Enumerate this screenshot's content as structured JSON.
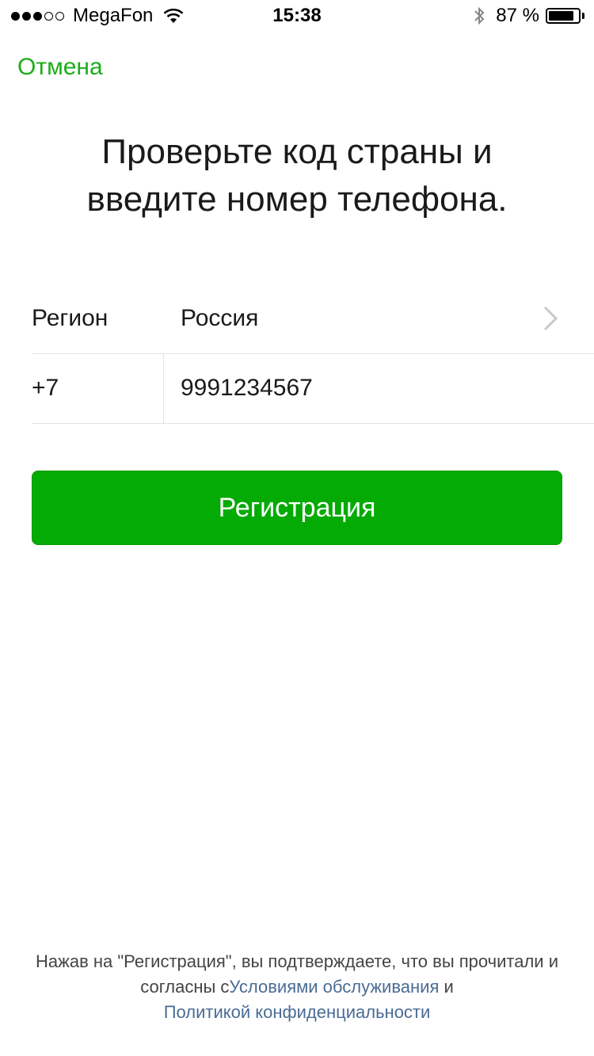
{
  "status_bar": {
    "carrier": "MegaFon",
    "signal_bars_filled": 3,
    "signal_bars_total": 5,
    "time": "15:38",
    "battery_percent_text": "87 %",
    "battery_level": 0.87
  },
  "nav": {
    "cancel_label": "Отмена"
  },
  "title": {
    "line1": "Проверьте код страны и",
    "line2": "введите номер телефона."
  },
  "form": {
    "region_label": "Регион",
    "region_value": "Россия",
    "country_code": "+7",
    "phone_value": "9991234567"
  },
  "register_button": {
    "label": "Регистрация"
  },
  "terms": {
    "prefix": "Нажав на \"Регистрация\", вы подтверждаете, что вы прочитали и согласны с",
    "tos_link": "Условиями обслуживания",
    "and": " и ",
    "privacy_link": "Политикой конфиденциальности"
  },
  "colors": {
    "accent_green": "#1aad19",
    "button_green": "#04ab05",
    "link_blue": "#4a6b94"
  }
}
